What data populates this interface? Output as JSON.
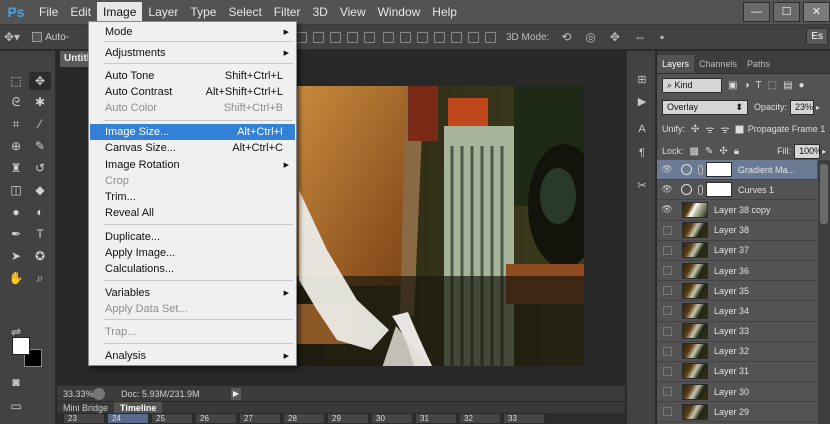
{
  "app": {
    "logo": "Ps"
  },
  "menubar": {
    "items": [
      "File",
      "Edit",
      "Image",
      "Layer",
      "Type",
      "Select",
      "Filter",
      "3D",
      "View",
      "Window",
      "Help"
    ],
    "active": "Image"
  },
  "window_controls": {
    "minimize": "—",
    "maximize": "☐",
    "close": "✕"
  },
  "options_bar": {
    "auto_label": "Auto-",
    "mode_3d": "3D Mode:",
    "essentials": "Es"
  },
  "document": {
    "tab_label": "Untitl"
  },
  "image_menu": {
    "items": [
      {
        "label": "Mode",
        "shortcut": "",
        "submenu": true,
        "disabled": false,
        "highlighted": false
      },
      {
        "label": "Adjustments",
        "shortcut": "",
        "submenu": true,
        "disabled": false,
        "highlighted": false
      },
      {
        "label": "Auto Tone",
        "shortcut": "Shift+Ctrl+L",
        "submenu": false,
        "disabled": false,
        "highlighted": false
      },
      {
        "label": "Auto Contrast",
        "shortcut": "Alt+Shift+Ctrl+L",
        "submenu": false,
        "disabled": false,
        "highlighted": false
      },
      {
        "label": "Auto Color",
        "shortcut": "Shift+Ctrl+B",
        "submenu": false,
        "disabled": true,
        "highlighted": false
      },
      {
        "label": "Image Size...",
        "shortcut": "Alt+Ctrl+I",
        "submenu": false,
        "disabled": false,
        "highlighted": true
      },
      {
        "label": "Canvas Size...",
        "shortcut": "Alt+Ctrl+C",
        "submenu": false,
        "disabled": false,
        "highlighted": false
      },
      {
        "label": "Image Rotation",
        "shortcut": "",
        "submenu": true,
        "disabled": false,
        "highlighted": false
      },
      {
        "label": "Crop",
        "shortcut": "",
        "submenu": false,
        "disabled": true,
        "highlighted": false
      },
      {
        "label": "Trim...",
        "shortcut": "",
        "submenu": false,
        "disabled": false,
        "highlighted": false
      },
      {
        "label": "Reveal All",
        "shortcut": "",
        "submenu": false,
        "disabled": false,
        "highlighted": false
      },
      {
        "label": "Duplicate...",
        "shortcut": "",
        "submenu": false,
        "disabled": false,
        "highlighted": false
      },
      {
        "label": "Apply Image...",
        "shortcut": "",
        "submenu": false,
        "disabled": false,
        "highlighted": false
      },
      {
        "label": "Calculations...",
        "shortcut": "",
        "submenu": false,
        "disabled": false,
        "highlighted": false
      },
      {
        "label": "Variables",
        "shortcut": "",
        "submenu": true,
        "disabled": false,
        "highlighted": false
      },
      {
        "label": "Apply Data Set...",
        "shortcut": "",
        "submenu": false,
        "disabled": true,
        "highlighted": false
      },
      {
        "label": "Trap...",
        "shortcut": "",
        "submenu": false,
        "disabled": true,
        "highlighted": false
      },
      {
        "label": "Analysis",
        "shortcut": "",
        "submenu": true,
        "disabled": false,
        "highlighted": false
      }
    ]
  },
  "status_bar": {
    "zoom": "33.33%",
    "doc": "Doc: 5.93M/231.9M",
    "arrow": "▶"
  },
  "bottom_tabs": {
    "tabs": [
      "Mini Bridge",
      "Timeline"
    ],
    "active": "Timeline"
  },
  "timeline": {
    "frames": [
      "23",
      "24",
      "25",
      "26",
      "27",
      "28",
      "29",
      "30",
      "31",
      "32",
      "33"
    ],
    "selected": "24"
  },
  "layers_panel": {
    "tabs": [
      "Layers",
      "Channels",
      "Paths"
    ],
    "active_tab": "Layers",
    "filter_kind": "Kind",
    "blend_mode": "Overlay",
    "opacity_label": "Opacity:",
    "opacity_value": "23%",
    "unify_label": "Unify:",
    "propagate_label": "Propagate Frame 1",
    "lock_label": "Lock:",
    "fill_label": "Fill:",
    "fill_value": "100%",
    "layers": [
      {
        "name": "Gradient Ma...",
        "type": "adjustment",
        "visible": true,
        "selected": true
      },
      {
        "name": "Curves 1",
        "type": "adjustment",
        "visible": true,
        "selected": false
      },
      {
        "name": "Layer 38 copy",
        "type": "image",
        "visible": true,
        "selected": false
      },
      {
        "name": "Layer 38",
        "type": "image",
        "visible": false,
        "selected": false
      },
      {
        "name": "Layer 37",
        "type": "image",
        "visible": false,
        "selected": false
      },
      {
        "name": "Layer 36",
        "type": "image",
        "visible": false,
        "selected": false
      },
      {
        "name": "Layer 35",
        "type": "image",
        "visible": false,
        "selected": false
      },
      {
        "name": "Layer 34",
        "type": "image",
        "visible": false,
        "selected": false
      },
      {
        "name": "Layer 33",
        "type": "image",
        "visible": false,
        "selected": false
      },
      {
        "name": "Layer 32",
        "type": "image",
        "visible": false,
        "selected": false
      },
      {
        "name": "Layer 31",
        "type": "image",
        "visible": false,
        "selected": false
      },
      {
        "name": "Layer 30",
        "type": "image",
        "visible": false,
        "selected": false
      },
      {
        "name": "Layer 29",
        "type": "image",
        "visible": false,
        "selected": false
      }
    ]
  },
  "colors": {
    "menu_highlight": "#3380d8",
    "selected_layer": "#6b7b95",
    "panel_bg": "#535353"
  }
}
